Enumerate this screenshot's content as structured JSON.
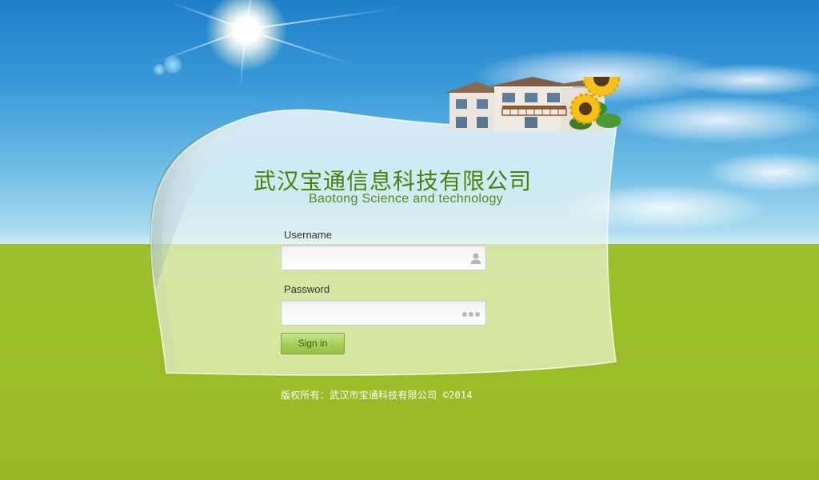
{
  "company": {
    "name_cn": "武汉宝通信息科技有限公司",
    "name_en": "Baotong Science and technology"
  },
  "login": {
    "username_label": "Username",
    "username_value": "",
    "password_label": "Password",
    "password_value": "",
    "signin_label": "Sign in"
  },
  "footer": {
    "copyright": "版权所有：武汉市宝通科技有限公司 ©2014"
  },
  "colors": {
    "brand_green": "#4f7e0d",
    "grass": "#9bbd28",
    "sky": "#3a9ad8"
  },
  "icons": {
    "username_icon": "user-icon",
    "password_icon": "dots-icon"
  }
}
